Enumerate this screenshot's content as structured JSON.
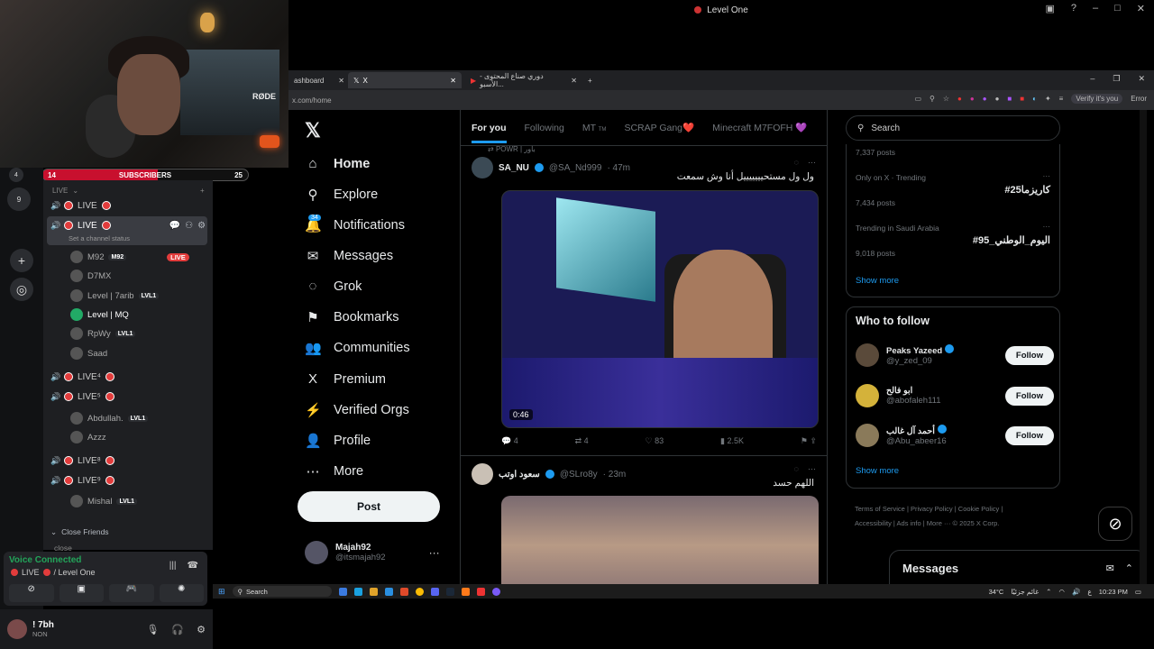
{
  "discord_window": {
    "title": "Level One"
  },
  "webcam": {
    "mic_brand": "RØDE"
  },
  "subscriber_bar": {
    "left": "14",
    "label": "SUBSCRIBERS",
    "right": "25",
    "progress": 0.56
  },
  "server_badges": [
    "4",
    "9"
  ],
  "channels": {
    "category_live": "LIVE",
    "category_close": "Close Friends",
    "channel_1": "LIVE",
    "channel_2": "LIVE",
    "channel_status_placeholder": "Set a channel status",
    "channel_3": "LIVE⁴",
    "channel_4": "LIVE⁵",
    "channel_5": "LIVE⁸",
    "channel_6": "LIVE⁹",
    "close_item": "close",
    "users": [
      {
        "name": "M92",
        "badge": "M92",
        "live": "LIVE"
      },
      {
        "name": "D7MX"
      },
      {
        "name": "Level | 7arib",
        "badge": "LVL1"
      },
      {
        "name": "Level | MQ"
      },
      {
        "name": "RpWy",
        "badge": "LVL1"
      },
      {
        "name": "Saad"
      },
      {
        "name": "Abdullah.",
        "badge": "LVL1"
      },
      {
        "name": "Azzz"
      },
      {
        "name": "Mishal",
        "badge": "LVL1"
      }
    ]
  },
  "voice": {
    "status": "Voice Connected",
    "location_a": "LIVE",
    "location_b": "/ Level One"
  },
  "user": {
    "name": "! 7bh",
    "status": "NON"
  },
  "browser": {
    "tabs": [
      {
        "label": "ashboard"
      },
      {
        "label": "X"
      },
      {
        "label": "دوري صناع المحتوى - الأسبو..."
      }
    ],
    "url": "x.com/home",
    "profile_chip": "Verify it's you",
    "error_chip": "Error"
  },
  "x_nav": {
    "items": [
      {
        "label": "Home",
        "icon": "home-icon",
        "glyph": "⌂"
      },
      {
        "label": "Explore",
        "icon": "search-icon",
        "glyph": "⚲"
      },
      {
        "label": "Notifications",
        "icon": "bell-icon",
        "glyph": "🔔"
      },
      {
        "label": "Messages",
        "icon": "mail-icon",
        "glyph": "✉"
      },
      {
        "label": "Grok",
        "icon": "grok-icon",
        "glyph": "◌"
      },
      {
        "label": "Bookmarks",
        "icon": "bookmark-icon",
        "glyph": "⚑"
      },
      {
        "label": "Communities",
        "icon": "communities-icon",
        "glyph": "👥"
      },
      {
        "label": "Premium",
        "icon": "x-logo-icon",
        "glyph": "X"
      },
      {
        "label": "Verified Orgs",
        "icon": "lightning-icon",
        "glyph": "⚡"
      },
      {
        "label": "Profile",
        "icon": "person-icon",
        "glyph": "👤"
      },
      {
        "label": "More",
        "icon": "more-circle-icon",
        "glyph": "⋯"
      }
    ],
    "notifications_count": "34",
    "post_label": "Post",
    "me_name": "Majah92",
    "me_handle": "@itsmajah92"
  },
  "feed": {
    "tabs": [
      "For you",
      "Following",
      "MT",
      "SCRAP Gang❤️",
      "Minecraft M7FOFH 💜"
    ],
    "mt_suffix": "TM",
    "reposted_by": "POWR | باور",
    "tweet1": {
      "name": "SA_NU",
      "handle": "@SA_Nd999",
      "time": "· 47m",
      "text": "ول ول مستحيييييييل أنا وش سمعت",
      "duration": "0:46",
      "replies": "4",
      "reposts": "4",
      "likes": "83",
      "views": "2.5K"
    },
    "tweet2": {
      "name": "سعود اوتب",
      "handle": "@SLro8y",
      "time": "· 23m",
      "text": "اللهم حسد"
    }
  },
  "right": {
    "search_placeholder": "Search",
    "trend0_posts": "7,337 posts",
    "trend1_context": "Only on X · Trending",
    "trend1_name": "#كاريزما25",
    "trend1_posts": "7,434 posts",
    "trend2_context": "Trending in Saudi Arabia",
    "trend2_name": "#اليوم_الوطني_95",
    "trend2_posts": "9,018 posts",
    "show_more": "Show more",
    "wtf_title": "Who to follow",
    "follow_label": "Follow",
    "who_to_follow": [
      {
        "name": "Peaks Yazeed",
        "handle": "@y_zed_09"
      },
      {
        "name": "ابو فالح",
        "handle": "@abofaleh111"
      },
      {
        "name": "أحمد آل غالب",
        "handle": "@Abu_abeer16"
      }
    ],
    "footer": {
      "terms": "Terms of Service",
      "privacy": "Privacy Policy",
      "cookie": "Cookie Policy",
      "accessibility": "Accessibility",
      "ads": "Ads info",
      "more": "More ···",
      "copyright": "© 2025 X Corp."
    },
    "messages_label": "Messages"
  },
  "taskbar": {
    "search": "Search",
    "weather": "34°C",
    "weather_desc": "غائم جزئيًا",
    "lang": "ع",
    "time": "10:23 PM"
  }
}
